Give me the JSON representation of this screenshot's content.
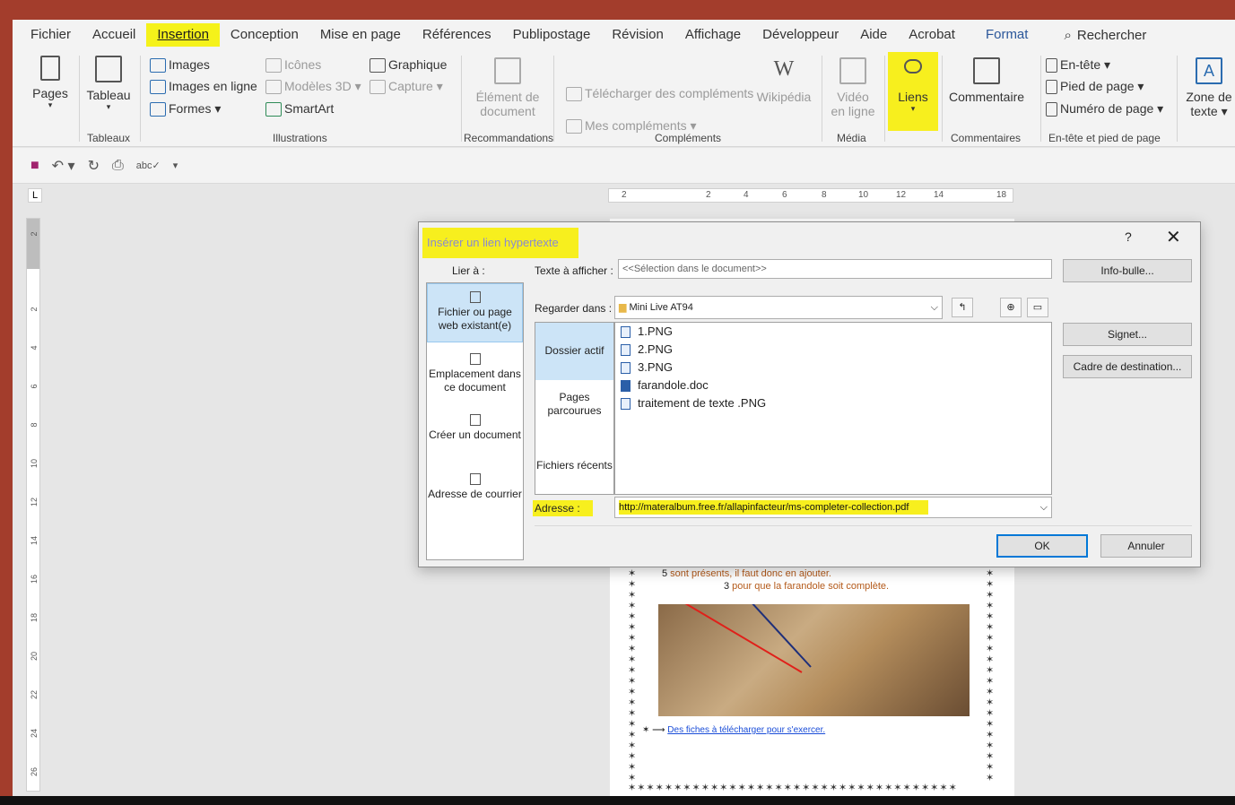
{
  "menu": {
    "tabs": [
      "Fichier",
      "Accueil",
      "Insertion",
      "Conception",
      "Mise en page",
      "Références",
      "Publipostage",
      "Révision",
      "Affichage",
      "Développeur",
      "Aide",
      "Acrobat",
      "Format"
    ],
    "active_tab": "Insertion",
    "search_label": "Rechercher"
  },
  "ribbon": {
    "pages": "Pages",
    "tableau": "Tableau",
    "tableaux_group": "Tableaux",
    "images": "Images",
    "images_en_ligne": "Images en ligne",
    "formes": "Formes ▾",
    "icones": "Icônes",
    "modeles_3d": "Modèles 3D ▾",
    "smartart": "SmartArt",
    "graphique": "Graphique",
    "capture": "Capture ▾",
    "illustrations_group": "Illustrations",
    "element_line1": "Élément de",
    "element_line2": "document",
    "recommandations_group": "Recommandations",
    "telecharger": "Télécharger des compléments",
    "mes_complements": "Mes compléments ▾",
    "wikipedia": "Wikipédia",
    "complements_group": "Compléments",
    "video_line1": "Vidéo",
    "video_line2": "en ligne",
    "media_group": "Média",
    "liens": "Liens",
    "commentaire": "Commentaire",
    "commentaires_group": "Commentaires",
    "en_tete": "En-tête ▾",
    "pied_de_page": "Pied de page ▾",
    "numero_de_page": "Numéro de page ▾",
    "entete_group": "En-tête et pied de page",
    "zone_line1": "Zone de",
    "zone_line2": "texte ▾"
  },
  "ruler": {
    "h_ticks": [
      "2",
      "2",
      "4",
      "6",
      "8",
      "10",
      "12",
      "14",
      "18"
    ],
    "v_ticks": [
      "2",
      "2",
      "4",
      "6",
      "8",
      "10",
      "12",
      "14",
      "16",
      "18",
      "20",
      "22",
      "24",
      "26"
    ]
  },
  "document": {
    "line1_num": "5",
    "line1_text": " sont présents, il faut donc en ajouter.",
    "line2_num": "3",
    "line2_text": " pour que la farandole soit complète.",
    "link_text": "Des fiches à télécharger pour s'exercer."
  },
  "dialog": {
    "title": "Insérer un lien hypertexte",
    "help": "?",
    "close": "✕",
    "lier_a": "Lier à :",
    "link_types": [
      {
        "label": "Fichier ou page web existant(e)"
      },
      {
        "label": "Emplacement dans ce document"
      },
      {
        "label": "Créer un document"
      },
      {
        "label": "Adresse de courrier"
      }
    ],
    "texte_label": "Texte à afficher :",
    "texte_value": "<<Sélection dans le document>>",
    "info_bulle": "Info-bulle...",
    "regarder_label": "Regarder dans :",
    "regarder_value": "Mini Live AT94",
    "browse_tabs": [
      "Dossier actif",
      "Pages parcourues",
      "Fichiers récents"
    ],
    "files": [
      {
        "name": "1.PNG",
        "type": "png"
      },
      {
        "name": "2.PNG",
        "type": "png"
      },
      {
        "name": "3.PNG",
        "type": "png"
      },
      {
        "name": "farandole.doc",
        "type": "doc"
      },
      {
        "name": "traitement de texte .PNG",
        "type": "png"
      }
    ],
    "signet": "Signet...",
    "cadre": "Cadre de destination...",
    "adresse_label": "Adresse :",
    "adresse_value": "http://materalbum.free.fr/allapinfacteur/ms-completer-collection.pdf",
    "ok": "OK",
    "annuler": "Annuler"
  }
}
